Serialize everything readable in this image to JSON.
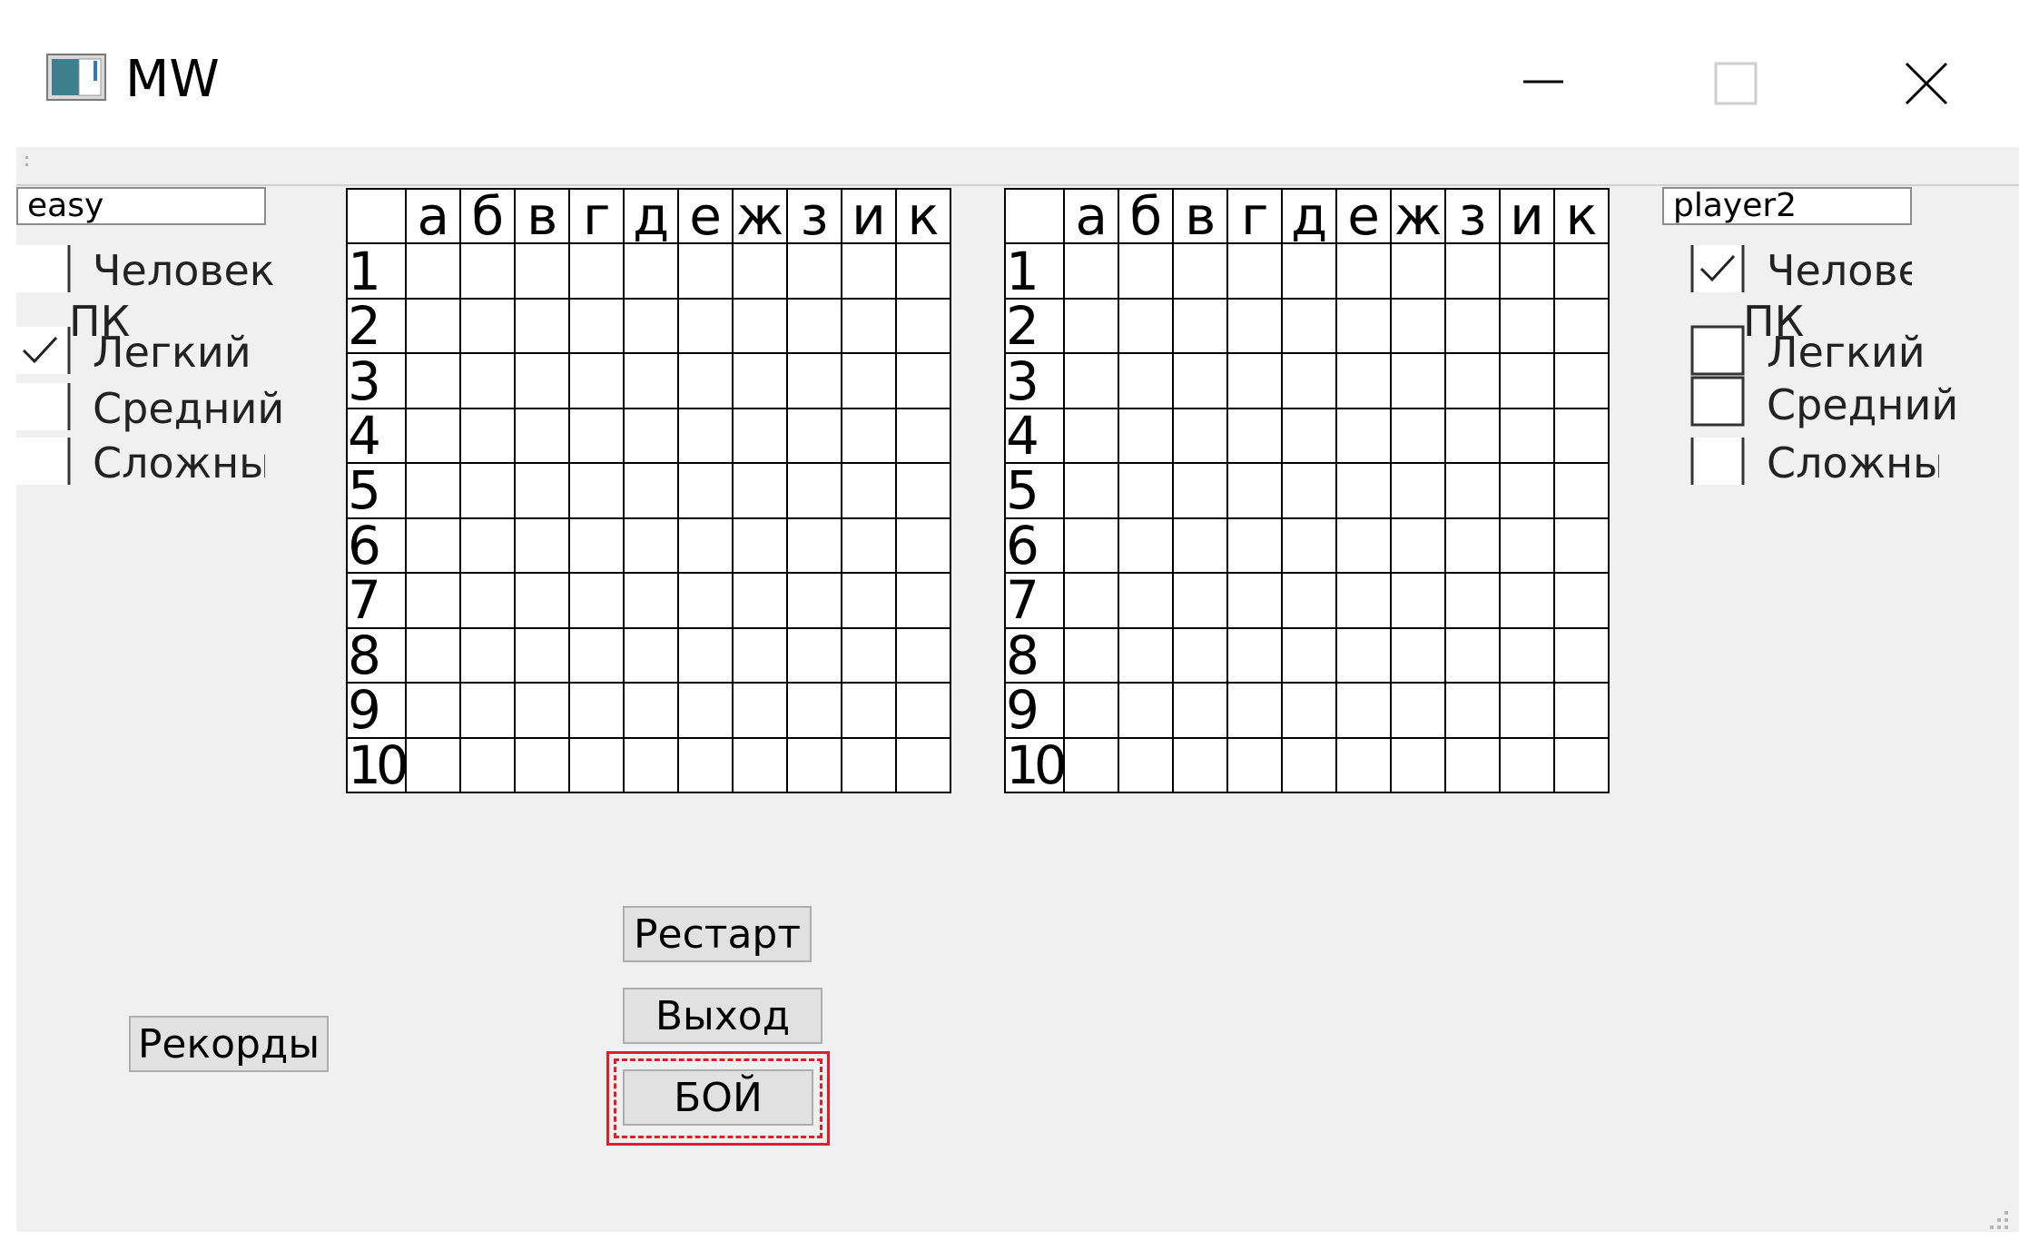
{
  "window": {
    "title": "MW",
    "app_icon": "app-window-icon",
    "controls": [
      "minimize-icon",
      "maximize-icon",
      "close-icon"
    ]
  },
  "left_panel": {
    "name_input": {
      "value": "easy",
      "placeholder": ""
    },
    "human_label": "Человек",
    "pc_label": "ПК",
    "levels": [
      {
        "label": "Легкий",
        "checked": true
      },
      {
        "label": "Средний",
        "checked": false
      },
      {
        "label": "Сложный",
        "checked": false
      }
    ],
    "human_checked": false
  },
  "right_panel": {
    "name_input": {
      "value": "player2",
      "placeholder": ""
    },
    "human_label": "Человек",
    "pc_label": "ПК",
    "levels": [
      {
        "label": "Легкий",
        "checked": false
      },
      {
        "label": "Средний",
        "checked": false
      },
      {
        "label": "Сложный",
        "checked": false
      }
    ],
    "human_checked": true
  },
  "board": {
    "columns": [
      "а",
      "б",
      "в",
      "г",
      "д",
      "е",
      "ж",
      "з",
      "и",
      "к"
    ],
    "rows": [
      "1",
      "2",
      "3",
      "4",
      "5",
      "6",
      "7",
      "8",
      "9",
      "10"
    ]
  },
  "buttons": {
    "restart": "Рестарт",
    "exit": "Выход",
    "fight": "БОЙ",
    "records": "Рекорды"
  },
  "colors": {
    "client_bg": "#f0f0f0",
    "focus_red": "#e01e2b",
    "button_bg": "#e1e1e1"
  }
}
